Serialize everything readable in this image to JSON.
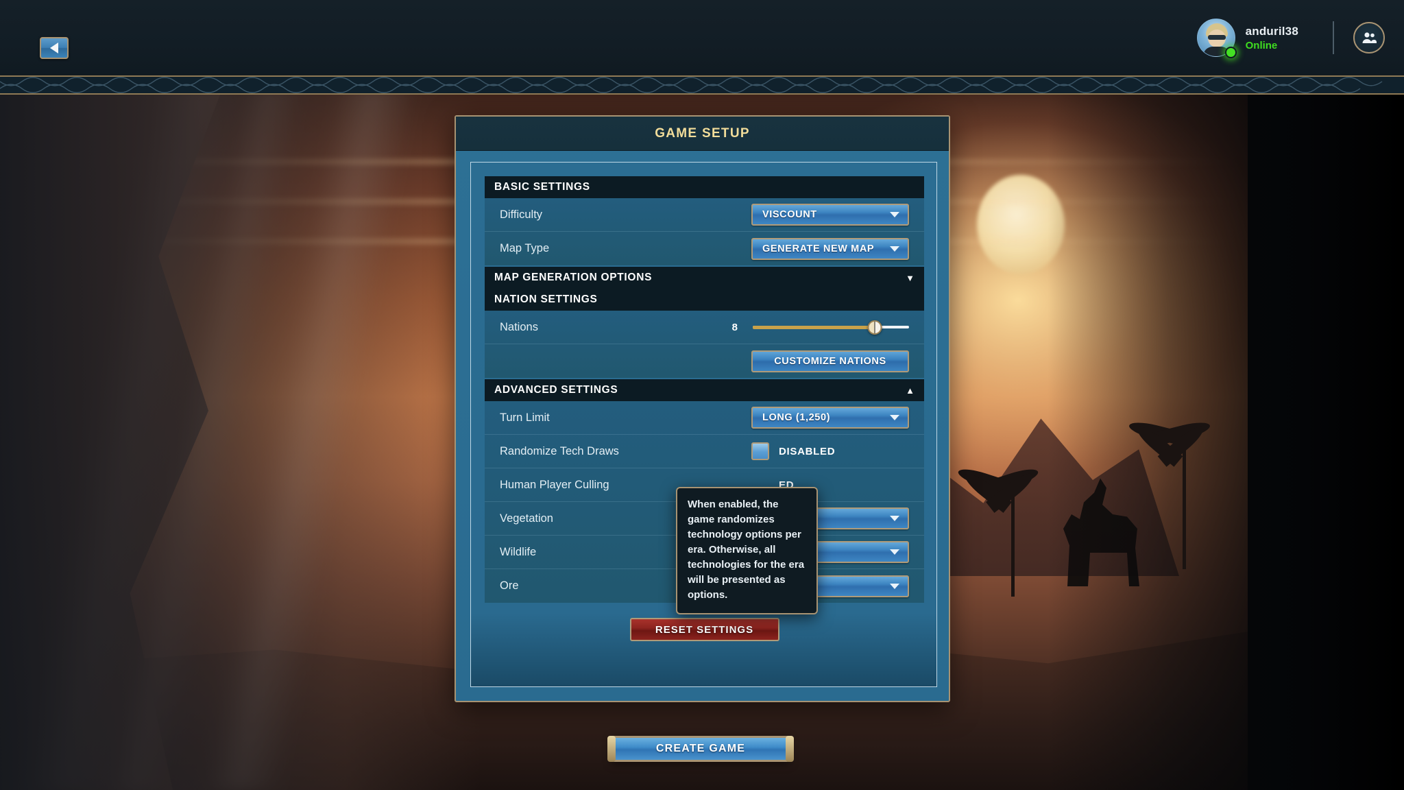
{
  "topbar": {
    "back_button_icon": "triangle-left-icon",
    "user": {
      "name": "anduril38",
      "status": "Online",
      "status_color": "#3fdd20",
      "avatar_icon": "avatar",
      "friends_button_icon": "people-icon"
    }
  },
  "panel": {
    "title": "GAME SETUP",
    "title_color": "#f2dd9a",
    "sections": [
      {
        "id": "basic",
        "header": "BASIC SETTINGS",
        "caret": "",
        "rows": [
          {
            "label": "Difficulty",
            "control": "dropdown",
            "value": "VISCOUNT"
          },
          {
            "label": "Map Type",
            "control": "dropdown",
            "value": "GENERATE NEW MAP"
          }
        ]
      },
      {
        "id": "mapgen",
        "header": "MAP GENERATION OPTIONS",
        "caret": "▼",
        "collapsed": true,
        "rows": []
      },
      {
        "id": "nation",
        "header": "NATION SETTINGS",
        "caret": "",
        "rows": [
          {
            "label": "Nations",
            "control": "slider",
            "value": "8",
            "percent": 78
          },
          {
            "label": "",
            "control": "button",
            "value": "CUSTOMIZE NATIONS"
          }
        ]
      },
      {
        "id": "advanced",
        "header": "ADVANCED SETTINGS",
        "caret": "▲",
        "rows": [
          {
            "label": "Turn Limit",
            "control": "dropdown",
            "value": "LONG (1,250)"
          },
          {
            "label": "Randomize Tech Draws",
            "control": "checkbox",
            "value": "DISABLED"
          },
          {
            "label": "Human Player Culling",
            "control": "checkbox",
            "value": "ED"
          },
          {
            "label": "Vegetation",
            "control": "dropdown",
            "value": ""
          },
          {
            "label": "Wildlife",
            "control": "dropdown",
            "value": ""
          },
          {
            "label": "Ore",
            "control": "dropdown",
            "value": ""
          }
        ]
      }
    ],
    "reset_button": "RESET SETTINGS"
  },
  "tooltip": {
    "text": "When enabled, the game randomizes technology options per era. Otherwise, all technologies for the era will be presented as options."
  },
  "footer": {
    "create_button": "CREATE GAME"
  },
  "colors": {
    "accent_gold": "#a89372",
    "panel_blue": "#2d7095",
    "section_dark": "#0c1b23",
    "button_blue": "#3d85c1",
    "button_red": "#8e241f"
  }
}
